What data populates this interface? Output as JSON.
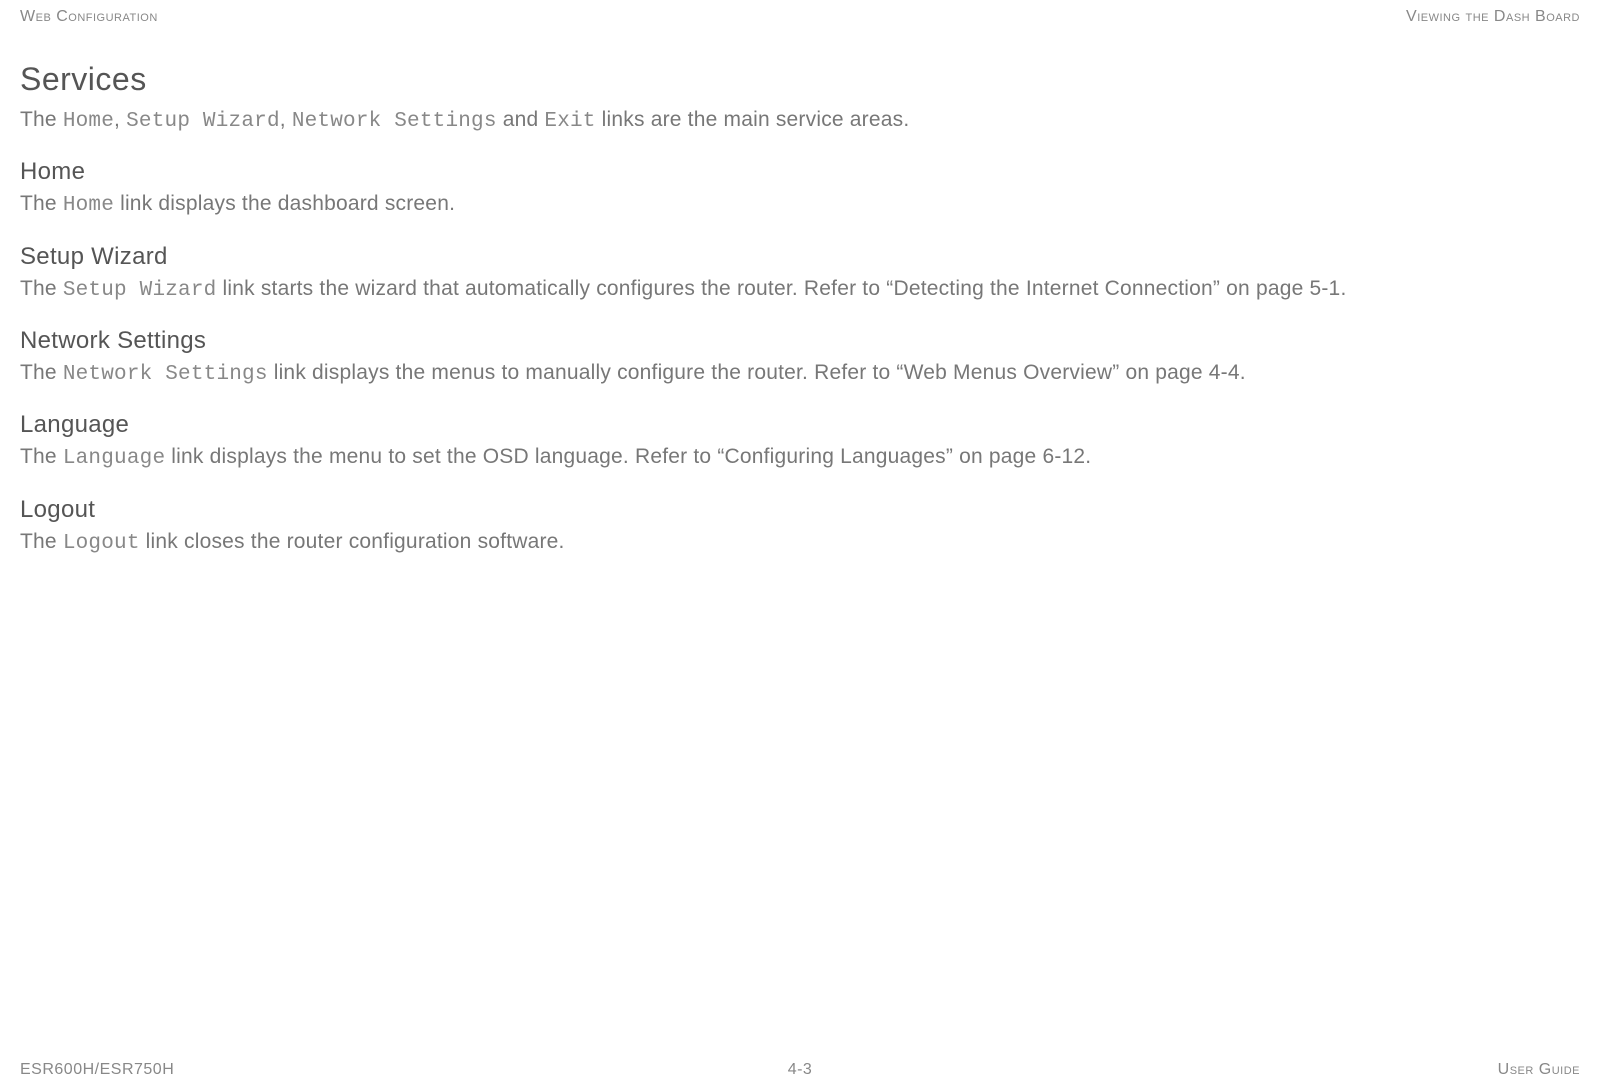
{
  "header": {
    "left": "Web Configuration",
    "right": "Viewing the Dash Board"
  },
  "sections": {
    "services": {
      "title": "Services",
      "intro": {
        "t1": "The ",
        "m1": "Home",
        "t2": ", ",
        "m2": "Setup Wizard",
        "t3": ", ",
        "m3": "Network Settings",
        "t4": " and ",
        "m4": "Exit",
        "t5": " links are the main service areas."
      }
    },
    "home": {
      "title": "Home",
      "body": {
        "t1": "The ",
        "m1": "Home",
        "t2": " link displays the dashboard screen."
      }
    },
    "setup": {
      "title": "Setup Wizard",
      "body": {
        "t1": "The ",
        "m1": "Setup Wizard",
        "t2": " link starts the wizard that automatically configures the router. Refer to “Detecting the Internet Connection” on page 5-1."
      }
    },
    "network": {
      "title": "Network Settings",
      "body": {
        "t1": "The ",
        "m1": "Network Settings",
        "t2": " link displays the menus to manually configure the router.  Refer to “Web Menus Overview” on page 4-4."
      }
    },
    "language": {
      "title": "Language",
      "body": {
        "t1": "The ",
        "m1": "Language",
        "t2": " link displays the menu to set the OSD language. Refer to “Configuring Languages” on page 6-12."
      }
    },
    "logout": {
      "title": "Logout",
      "body": {
        "t1": "The ",
        "m1": "Logout",
        "t2": " link closes the router configuration software."
      }
    }
  },
  "footer": {
    "left": "ESR600H/ESR750H",
    "center": "4-3",
    "right": "User Guide"
  }
}
